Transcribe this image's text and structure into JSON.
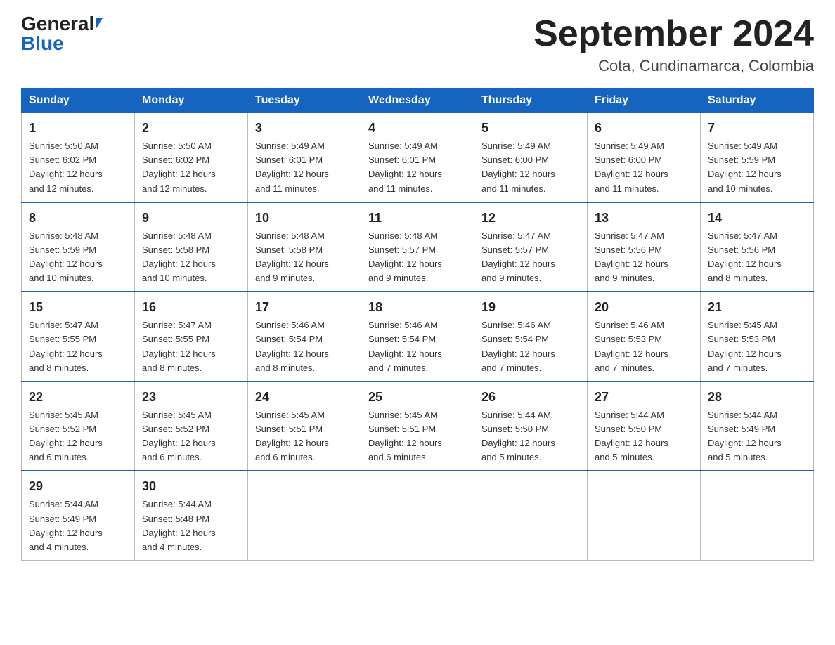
{
  "header": {
    "logo_general": "General",
    "logo_blue": "Blue",
    "title": "September 2024",
    "subtitle": "Cota, Cundinamarca, Colombia"
  },
  "days_of_week": [
    "Sunday",
    "Monday",
    "Tuesday",
    "Wednesday",
    "Thursday",
    "Friday",
    "Saturday"
  ],
  "weeks": [
    [
      {
        "date": "1",
        "sunrise": "5:50 AM",
        "sunset": "6:02 PM",
        "daylight": "12 hours and 12 minutes."
      },
      {
        "date": "2",
        "sunrise": "5:50 AM",
        "sunset": "6:02 PM",
        "daylight": "12 hours and 12 minutes."
      },
      {
        "date": "3",
        "sunrise": "5:49 AM",
        "sunset": "6:01 PM",
        "daylight": "12 hours and 11 minutes."
      },
      {
        "date": "4",
        "sunrise": "5:49 AM",
        "sunset": "6:01 PM",
        "daylight": "12 hours and 11 minutes."
      },
      {
        "date": "5",
        "sunrise": "5:49 AM",
        "sunset": "6:00 PM",
        "daylight": "12 hours and 11 minutes."
      },
      {
        "date": "6",
        "sunrise": "5:49 AM",
        "sunset": "6:00 PM",
        "daylight": "12 hours and 11 minutes."
      },
      {
        "date": "7",
        "sunrise": "5:49 AM",
        "sunset": "5:59 PM",
        "daylight": "12 hours and 10 minutes."
      }
    ],
    [
      {
        "date": "8",
        "sunrise": "5:48 AM",
        "sunset": "5:59 PM",
        "daylight": "12 hours and 10 minutes."
      },
      {
        "date": "9",
        "sunrise": "5:48 AM",
        "sunset": "5:58 PM",
        "daylight": "12 hours and 10 minutes."
      },
      {
        "date": "10",
        "sunrise": "5:48 AM",
        "sunset": "5:58 PM",
        "daylight": "12 hours and 9 minutes."
      },
      {
        "date": "11",
        "sunrise": "5:48 AM",
        "sunset": "5:57 PM",
        "daylight": "12 hours and 9 minutes."
      },
      {
        "date": "12",
        "sunrise": "5:47 AM",
        "sunset": "5:57 PM",
        "daylight": "12 hours and 9 minutes."
      },
      {
        "date": "13",
        "sunrise": "5:47 AM",
        "sunset": "5:56 PM",
        "daylight": "12 hours and 9 minutes."
      },
      {
        "date": "14",
        "sunrise": "5:47 AM",
        "sunset": "5:56 PM",
        "daylight": "12 hours and 8 minutes."
      }
    ],
    [
      {
        "date": "15",
        "sunrise": "5:47 AM",
        "sunset": "5:55 PM",
        "daylight": "12 hours and 8 minutes."
      },
      {
        "date": "16",
        "sunrise": "5:47 AM",
        "sunset": "5:55 PM",
        "daylight": "12 hours and 8 minutes."
      },
      {
        "date": "17",
        "sunrise": "5:46 AM",
        "sunset": "5:54 PM",
        "daylight": "12 hours and 8 minutes."
      },
      {
        "date": "18",
        "sunrise": "5:46 AM",
        "sunset": "5:54 PM",
        "daylight": "12 hours and 7 minutes."
      },
      {
        "date": "19",
        "sunrise": "5:46 AM",
        "sunset": "5:54 PM",
        "daylight": "12 hours and 7 minutes."
      },
      {
        "date": "20",
        "sunrise": "5:46 AM",
        "sunset": "5:53 PM",
        "daylight": "12 hours and 7 minutes."
      },
      {
        "date": "21",
        "sunrise": "5:45 AM",
        "sunset": "5:53 PM",
        "daylight": "12 hours and 7 minutes."
      }
    ],
    [
      {
        "date": "22",
        "sunrise": "5:45 AM",
        "sunset": "5:52 PM",
        "daylight": "12 hours and 6 minutes."
      },
      {
        "date": "23",
        "sunrise": "5:45 AM",
        "sunset": "5:52 PM",
        "daylight": "12 hours and 6 minutes."
      },
      {
        "date": "24",
        "sunrise": "5:45 AM",
        "sunset": "5:51 PM",
        "daylight": "12 hours and 6 minutes."
      },
      {
        "date": "25",
        "sunrise": "5:45 AM",
        "sunset": "5:51 PM",
        "daylight": "12 hours and 6 minutes."
      },
      {
        "date": "26",
        "sunrise": "5:44 AM",
        "sunset": "5:50 PM",
        "daylight": "12 hours and 5 minutes."
      },
      {
        "date": "27",
        "sunrise": "5:44 AM",
        "sunset": "5:50 PM",
        "daylight": "12 hours and 5 minutes."
      },
      {
        "date": "28",
        "sunrise": "5:44 AM",
        "sunset": "5:49 PM",
        "daylight": "12 hours and 5 minutes."
      }
    ],
    [
      {
        "date": "29",
        "sunrise": "5:44 AM",
        "sunset": "5:49 PM",
        "daylight": "12 hours and 4 minutes."
      },
      {
        "date": "30",
        "sunrise": "5:44 AM",
        "sunset": "5:48 PM",
        "daylight": "12 hours and 4 minutes."
      },
      null,
      null,
      null,
      null,
      null
    ]
  ],
  "labels": {
    "sunrise": "Sunrise:",
    "sunset": "Sunset:",
    "daylight": "Daylight:"
  }
}
